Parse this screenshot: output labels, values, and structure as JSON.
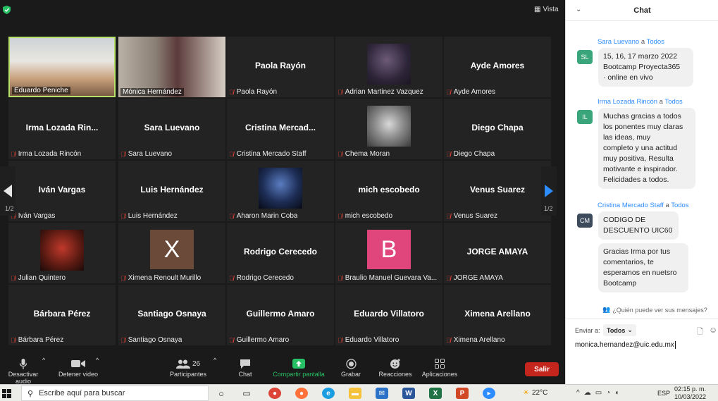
{
  "meeting": {
    "view_label": "Vista",
    "page_indicator_left": "1/2",
    "page_indicator_right": "1/2",
    "participants": [
      {
        "name": "Eduardo Peniche",
        "display": "",
        "kind": "video",
        "active": true
      },
      {
        "name": "Mónica Hernández",
        "display": "",
        "kind": "video",
        "active": false
      },
      {
        "name": "Paola Rayón",
        "display": "Paola Rayón",
        "kind": "name"
      },
      {
        "name": "Adrian Martinez Vazquez",
        "display": "",
        "kind": "photo"
      },
      {
        "name": "Ayde Amores",
        "display": "Ayde Amores",
        "kind": "name"
      },
      {
        "name": "Irma Lozada Rincón",
        "display": "Irma  Lozada  Rin...",
        "kind": "name"
      },
      {
        "name": "Sara Luevano",
        "display": "Sara Luevano",
        "kind": "name"
      },
      {
        "name": "Cristina Mercado Staff",
        "display": "Cristina  Mercad...",
        "kind": "name"
      },
      {
        "name": "Chema Moran",
        "display": "",
        "kind": "photo"
      },
      {
        "name": "Diego Chapa",
        "display": "Diego Chapa",
        "kind": "name"
      },
      {
        "name": "Iván Vargas",
        "display": "Iván Vargas",
        "kind": "name"
      },
      {
        "name": "Luis Hernández",
        "display": "Luis Hernández",
        "kind": "name"
      },
      {
        "name": "Aharon Marin Coba",
        "display": "",
        "kind": "photo"
      },
      {
        "name": "mich escobedo",
        "display": "mich escobedo",
        "kind": "name"
      },
      {
        "name": "Venus Suarez",
        "display": "Venus Suarez",
        "kind": "name"
      },
      {
        "name": "Julian Quintero",
        "display": "",
        "kind": "photo"
      },
      {
        "name": "Ximena Renoult Murillo",
        "display": "X",
        "kind": "avatar",
        "color": "#6b4a3a"
      },
      {
        "name": "Rodrigo Cerecedo",
        "display": "Rodrigo Cerecedo",
        "kind": "name"
      },
      {
        "name": "Braulio Manuel Guevara Va...",
        "display": "B",
        "kind": "avatar",
        "color": "#e0457b"
      },
      {
        "name": "JORGE AMAYA",
        "display": "JORGE AMAYA",
        "kind": "name"
      },
      {
        "name": "Bárbara Pérez",
        "display": "Bárbara Pérez",
        "kind": "name"
      },
      {
        "name": "Santiago Osnaya",
        "display": "Santiago Osnaya",
        "kind": "name"
      },
      {
        "name": "Guillermo Amaro",
        "display": "Guillermo Amaro",
        "kind": "name"
      },
      {
        "name": "Eduardo Villatoro",
        "display": "Eduardo Villatoro",
        "kind": "name"
      },
      {
        "name": "Ximena Arellano",
        "display": "Ximena Arellano",
        "kind": "name"
      }
    ]
  },
  "toolbar": {
    "mute_label": "Desactivar audio",
    "video_label": "Detener video",
    "participants_label": "Participantes",
    "participants_count": "26",
    "chat_label": "Chat",
    "share_label": "Compartir pantalla",
    "record_label": "Grabar",
    "reactions_label": "Reacciones",
    "apps_label": "Aplicaciones",
    "leave_label": "Salir"
  },
  "chat": {
    "title": "Chat",
    "to_word": "a",
    "messages": [
      {
        "sender": "Sara Luevano",
        "to": "Todos",
        "initials": "SL",
        "color": "#3aa57a",
        "lines": [
          "15, 16, 17 marzo 2022",
          "Bootcamp Proyecta365",
          "· online en vivo"
        ]
      },
      {
        "sender": "Irma Lozada Rincón",
        "to": "Todos",
        "initials": "IL",
        "color": "#3aa57a",
        "lines": [
          "Muchas gracias a todos",
          "los ponentes muy claras",
          "las ideas, muy",
          "completo y una actitud",
          "muy positiva, Resulta",
          "motivante e inspirador.",
          "Felicidades a todos."
        ]
      },
      {
        "sender": "Cristina Mercado Staff",
        "to": "Todos",
        "initials": "CM",
        "color": "#3c4a5c",
        "lines": [
          "CODIGO DE",
          "DESCUENTO UIC60"
        ],
        "lines2": [
          "Gracias Irma por tus",
          "comentarios, te",
          "esperamos en nuetsro",
          "Bootcamp"
        ]
      }
    ],
    "who_sees": "¿Quién puede ver sus mensajes?",
    "send_to_label": "Enviar a:",
    "send_to_value": "Todos",
    "input_value": "monica.hernandez@uic.edu.mx"
  },
  "taskbar": {
    "search_placeholder": "Escribe aquí para buscar",
    "temperature": "22°C",
    "language": "ESP",
    "time": "02:15 p. m.",
    "date": "10/03/2022"
  }
}
